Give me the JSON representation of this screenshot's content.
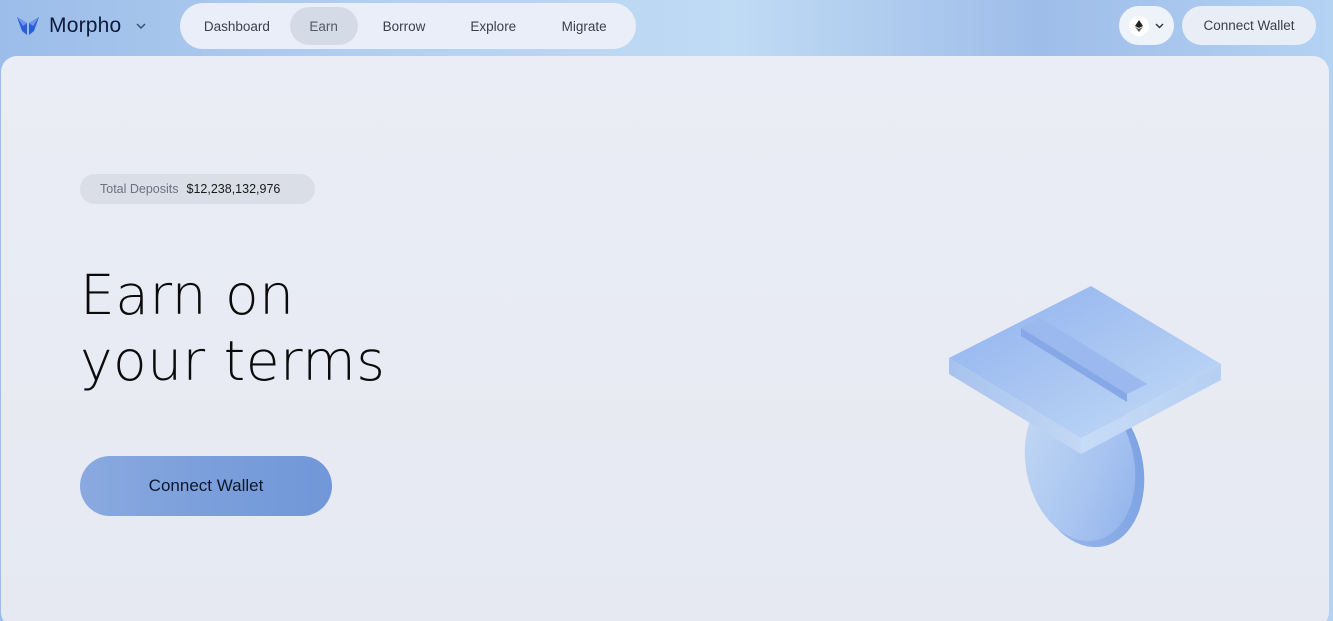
{
  "brand": {
    "name": "Morpho",
    "logo_icon": "butterfly-icon",
    "menu_icon": "chevron-down-icon",
    "accent_color": "#2b5fd9"
  },
  "nav": {
    "items": [
      {
        "label": "Dashboard",
        "active": false
      },
      {
        "label": "Earn",
        "active": true
      },
      {
        "label": "Borrow",
        "active": false
      },
      {
        "label": "Explore",
        "active": false
      },
      {
        "label": "Migrate",
        "active": false
      }
    ]
  },
  "network": {
    "icon": "ethereum-icon",
    "dropdown_icon": "chevron-down-icon"
  },
  "header": {
    "connect_label": "Connect Wallet"
  },
  "hero": {
    "deposits_label": "Total Deposits",
    "deposits_value": "$12,238,132,976",
    "headline_line1": "Earn on",
    "headline_line2": "your terms",
    "connect_label": "Connect Wallet",
    "button_color": "#7b9fdb",
    "illustration": "coin-slot-illustration"
  }
}
